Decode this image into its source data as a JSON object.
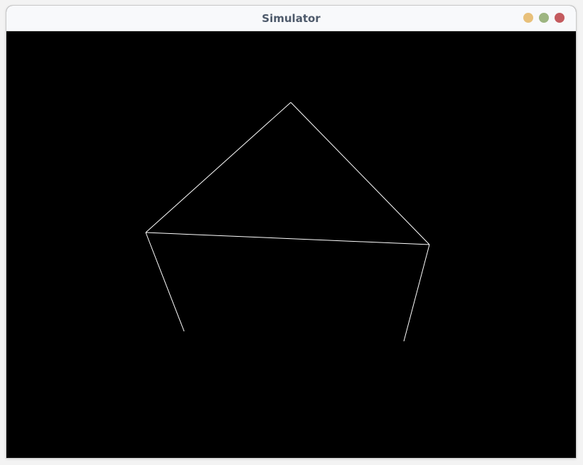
{
  "window": {
    "title": "Simulator",
    "controls": [
      {
        "name": "minimize-button",
        "icon": "minimize-icon",
        "color": "#e8c07a"
      },
      {
        "name": "maximize-button",
        "icon": "maximize-icon",
        "color": "#9db581"
      },
      {
        "name": "close-button",
        "icon": "close-icon",
        "color": "#c45b5f"
      }
    ]
  },
  "scene": {
    "background": "#000000",
    "line_color": "#ffffff"
  }
}
